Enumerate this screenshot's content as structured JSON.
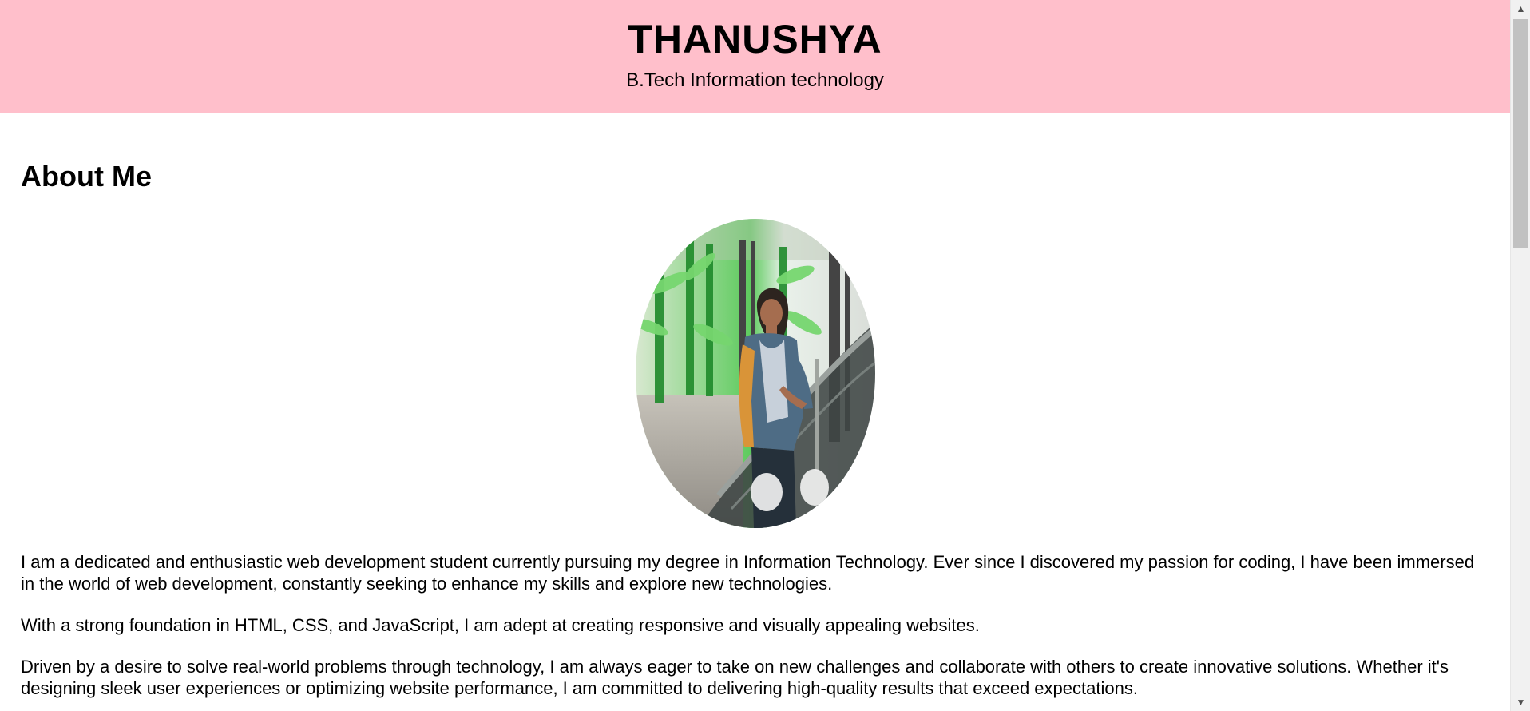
{
  "header": {
    "name": "THANUSHYA",
    "subtitle": "B.Tech Information technology",
    "background_color": "#ffbfcb"
  },
  "about": {
    "title": "About Me",
    "paragraphs": [
      "I am a dedicated and enthusiastic web development student currently pursuing my degree in Information Technology. Ever since I discovered my passion for coding, I have been immersed in the world of web development, constantly seeking to enhance my skills and explore new technologies.",
      "With a strong foundation in HTML, CSS, and JavaScript, I am adept at creating responsive and visually appealing websites.",
      "Driven by a desire to solve real-world problems through technology, I am always eager to take on new challenges and collaborate with others to create innovative solutions. Whether it's designing sleek user experiences or optimizing website performance, I am committed to delivering high-quality results that exceed expectations."
    ]
  },
  "icons": {
    "scroll_up": "triangle-up-icon",
    "scroll_down": "triangle-down-icon"
  },
  "symbols": {
    "scroll_up": "▲",
    "scroll_down": "▼"
  },
  "colors": {
    "header_bg": "#ffbfcb",
    "page_bg": "#ffffff",
    "text": "#000000"
  }
}
